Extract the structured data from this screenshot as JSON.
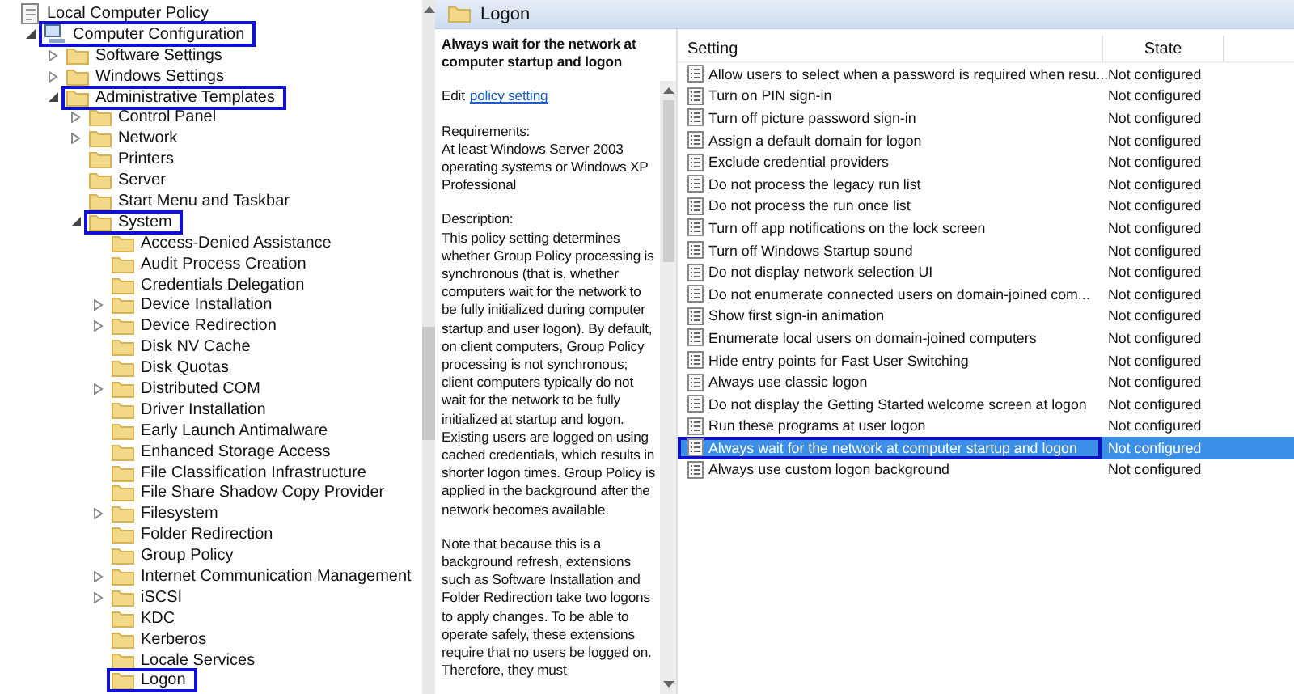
{
  "tree": [
    {
      "label": "Local Computer Policy",
      "kind": "policy",
      "highlighted": false,
      "children": [
        {
          "label": "Computer Configuration",
          "kind": "computer",
          "expanded": true,
          "highlighted": true,
          "children": [
            {
              "label": "Software Settings",
              "kind": "folder",
              "expanded": false,
              "highlighted": false
            },
            {
              "label": "Windows Settings",
              "kind": "folder",
              "expanded": false,
              "highlighted": false
            },
            {
              "label": "Administrative Templates",
              "kind": "folder",
              "expanded": true,
              "highlighted": true,
              "children": [
                {
                  "label": "Control Panel",
                  "kind": "folder",
                  "expanded": false,
                  "highlighted": false
                },
                {
                  "label": "Network",
                  "kind": "folder",
                  "expanded": false,
                  "highlighted": false
                },
                {
                  "label": "Printers",
                  "kind": "folder",
                  "highlighted": false
                },
                {
                  "label": "Server",
                  "kind": "folder",
                  "highlighted": false
                },
                {
                  "label": "Start Menu and Taskbar",
                  "kind": "folder",
                  "highlighted": false
                },
                {
                  "label": "System",
                  "kind": "folder",
                  "expanded": true,
                  "highlighted": true,
                  "children": [
                    {
                      "label": "Access-Denied Assistance",
                      "kind": "folder",
                      "highlighted": false
                    },
                    {
                      "label": "Audit Process Creation",
                      "kind": "folder",
                      "highlighted": false
                    },
                    {
                      "label": "Credentials Delegation",
                      "kind": "folder",
                      "highlighted": false
                    },
                    {
                      "label": "Device Installation",
                      "kind": "folder",
                      "expanded": false,
                      "highlighted": false
                    },
                    {
                      "label": "Device Redirection",
                      "kind": "folder",
                      "expanded": false,
                      "highlighted": false
                    },
                    {
                      "label": "Disk NV Cache",
                      "kind": "folder",
                      "highlighted": false
                    },
                    {
                      "label": "Disk Quotas",
                      "kind": "folder",
                      "highlighted": false
                    },
                    {
                      "label": "Distributed COM",
                      "kind": "folder",
                      "expanded": false,
                      "highlighted": false
                    },
                    {
                      "label": "Driver Installation",
                      "kind": "folder",
                      "highlighted": false
                    },
                    {
                      "label": "Early Launch Antimalware",
                      "kind": "folder",
                      "highlighted": false
                    },
                    {
                      "label": "Enhanced Storage Access",
                      "kind": "folder",
                      "highlighted": false
                    },
                    {
                      "label": "File Classification Infrastructure",
                      "kind": "folder",
                      "highlighted": false
                    },
                    {
                      "label": "File Share Shadow Copy Provider",
                      "kind": "folder",
                      "highlighted": false
                    },
                    {
                      "label": "Filesystem",
                      "kind": "folder",
                      "expanded": false,
                      "highlighted": false
                    },
                    {
                      "label": "Folder Redirection",
                      "kind": "folder",
                      "highlighted": false
                    },
                    {
                      "label": "Group Policy",
                      "kind": "folder",
                      "highlighted": false
                    },
                    {
                      "label": "Internet Communication Management",
                      "kind": "folder",
                      "expanded": false,
                      "highlighted": false
                    },
                    {
                      "label": "iSCSI",
                      "kind": "folder",
                      "expanded": false,
                      "highlighted": false
                    },
                    {
                      "label": "KDC",
                      "kind": "folder",
                      "highlighted": false
                    },
                    {
                      "label": "Kerberos",
                      "kind": "folder",
                      "highlighted": false
                    },
                    {
                      "label": "Locale Services",
                      "kind": "folder",
                      "highlighted": false
                    },
                    {
                      "label": "Logon",
                      "kind": "folder",
                      "highlighted": true
                    }
                  ]
                }
              ]
            }
          ]
        }
      ]
    }
  ],
  "header": {
    "title": "Logon"
  },
  "details": {
    "title": "Always wait for the network at computer startup and logon",
    "edit_prefix": "Edit",
    "edit_link": "policy setting",
    "requirements_label": "Requirements:",
    "requirements": "At least Windows Server 2003 operating systems or Windows XP Professional",
    "description_label": "Description:",
    "paragraphs": [
      "This policy setting determines whether Group Policy processing is synchronous (that is, whether computers wait for the network to be fully initialized during computer startup and user logon). By default, on client computers, Group Policy processing is not synchronous; client computers typically do not wait for the network to be fully initialized at startup and logon. Existing users are logged on using cached credentials, which results in shorter logon times. Group Policy is applied in the background after the network becomes available.",
      "Note that because this is a background refresh, extensions such as Software Installation and Folder Redirection take two logons to apply changes. To be able to operate safely, these extensions require that no users be logged on. Therefore, they must"
    ]
  },
  "table": {
    "columns": [
      "Setting",
      "State"
    ],
    "rows": [
      {
        "setting": "Allow users to select when a password is required when resu...",
        "state": "Not configured",
        "selected": false,
        "highlighted": false
      },
      {
        "setting": "Turn on PIN sign-in",
        "state": "Not configured",
        "selected": false,
        "highlighted": false
      },
      {
        "setting": "Turn off picture password sign-in",
        "state": "Not configured",
        "selected": false,
        "highlighted": false
      },
      {
        "setting": "Assign a default domain for logon",
        "state": "Not configured",
        "selected": false,
        "highlighted": false
      },
      {
        "setting": "Exclude credential providers",
        "state": "Not configured",
        "selected": false,
        "highlighted": false
      },
      {
        "setting": "Do not process the legacy run list",
        "state": "Not configured",
        "selected": false,
        "highlighted": false
      },
      {
        "setting": "Do not process the run once list",
        "state": "Not configured",
        "selected": false,
        "highlighted": false
      },
      {
        "setting": "Turn off app notifications on the lock screen",
        "state": "Not configured",
        "selected": false,
        "highlighted": false
      },
      {
        "setting": "Turn off Windows Startup sound",
        "state": "Not configured",
        "selected": false,
        "highlighted": false
      },
      {
        "setting": "Do not display network selection UI",
        "state": "Not configured",
        "selected": false,
        "highlighted": false
      },
      {
        "setting": "Do not enumerate connected users on domain-joined com...",
        "state": "Not configured",
        "selected": false,
        "highlighted": false
      },
      {
        "setting": "Show first sign-in animation",
        "state": "Not configured",
        "selected": false,
        "highlighted": false
      },
      {
        "setting": "Enumerate local users on domain-joined computers",
        "state": "Not configured",
        "selected": false,
        "highlighted": false
      },
      {
        "setting": "Hide entry points for Fast User Switching",
        "state": "Not configured",
        "selected": false,
        "highlighted": false
      },
      {
        "setting": "Always use classic logon",
        "state": "Not configured",
        "selected": false,
        "highlighted": false
      },
      {
        "setting": "Do not display the Getting Started welcome screen at logon",
        "state": "Not configured",
        "selected": false,
        "highlighted": false
      },
      {
        "setting": "Run these programs at user logon",
        "state": "Not configured",
        "selected": false,
        "highlighted": false
      },
      {
        "setting": "Always wait for the network at computer startup and logon",
        "state": "Not configured",
        "selected": true,
        "highlighted": true
      },
      {
        "setting": "Always use custom logon background",
        "state": "Not configured",
        "selected": false,
        "highlighted": false
      }
    ]
  }
}
